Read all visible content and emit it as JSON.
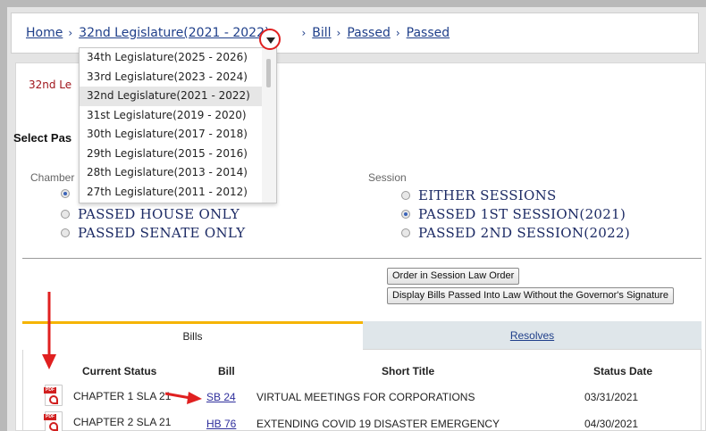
{
  "breadcrumb": {
    "home": "Home",
    "legislature": "32nd Legislature(2021 - 2022)",
    "bill": "Bill",
    "passed1": "Passed",
    "passed2": "Passed",
    "separator": "›"
  },
  "legislature_dropdown": {
    "options": [
      "34th Legislature(2025 - 2026)",
      "33rd Legislature(2023 - 2024)",
      "32nd Legislature(2021 - 2022)",
      "31st Legislature(2019 - 2020)",
      "30th Legislature(2017 - 2018)",
      "29th Legislature(2015 - 2016)",
      "28th Legislature(2013 - 2014)",
      "27th Legislature(2011 - 2012)"
    ],
    "selected": "32nd Legislature(2021 - 2022)"
  },
  "page": {
    "legislature_title_fragment": "32nd Le",
    "select_label_fragment": "Select Pas",
    "chamber_label_fragment": "Chamber",
    "session_label": "Session"
  },
  "chamber_options": [
    {
      "label": "PASSED HOUSE ONLY",
      "checked": false
    },
    {
      "label": "PASSED SENATE ONLY",
      "checked": false
    }
  ],
  "chamber_hidden_checked": true,
  "session_options": [
    {
      "label": "EITHER SESSIONS",
      "checked": false
    },
    {
      "label": "PASSED 1ST SESSION(2021)",
      "checked": true
    },
    {
      "label": "PASSED 2ND SESSION(2022)",
      "checked": false
    }
  ],
  "buttons": {
    "order_session_law": "Order in Session Law Order",
    "display_without_signature": "Display Bills Passed Into Law Without the Governor's Signature"
  },
  "tabs": {
    "bills": "Bills",
    "resolves": "Resolves"
  },
  "table": {
    "headers": {
      "current_status": "Current Status",
      "bill": "Bill",
      "short_title": "Short Title",
      "status_date": "Status Date"
    },
    "rows": [
      {
        "status": "CHAPTER 1 SLA 21",
        "bill": "SB 24",
        "title": "VIRTUAL MEETINGS FOR CORPORATIONS",
        "date": "03/31/2021"
      },
      {
        "status": "CHAPTER 2 SLA 21",
        "bill": "HB 76",
        "title": "EXTENDING COVID 19 DISASTER EMERGENCY",
        "date": "04/30/2021"
      }
    ]
  },
  "icons": {
    "dropdown_toggle": "chevron-down-icon",
    "pdf": "pdf-icon",
    "pdf_badge": "PDF"
  },
  "colors": {
    "link": "#1f3f8a",
    "annotation_red": "#e02020",
    "tab_accent": "#f5b400",
    "legislature_title": "#a0161c"
  }
}
